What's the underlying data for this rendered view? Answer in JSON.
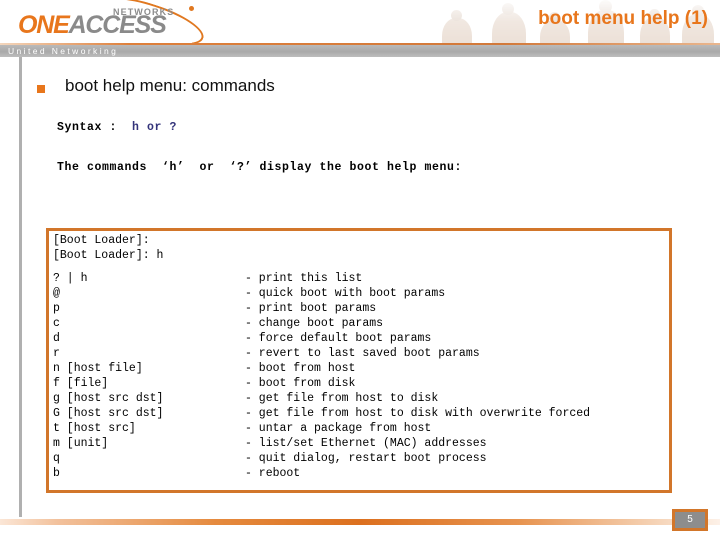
{
  "header": {
    "logo": {
      "networks_word": "NETWORKS",
      "brand_one": "ONE",
      "brand_access": "ACCESS"
    },
    "tagline": "United Networking",
    "slide_title": "boot menu help (1)",
    "accent_color": "#e8761c",
    "gray_bar_color": "#aeaeae"
  },
  "body": {
    "bullet_heading": "boot help menu: commands",
    "syntax": {
      "label": "Syntax :  ",
      "value": "h or ?",
      "value_color": "#33337a"
    },
    "description": "The commands  ‘h’  or  ‘?’ display the boot help menu:"
  },
  "code_box": {
    "border_color": "#d2762a",
    "prompt_lines": [
      "[Boot Loader]:",
      "[Boot Loader]: h"
    ],
    "commands": [
      {
        "key": "? | h",
        "desc": "- print this list"
      },
      {
        "key": "@",
        "desc": "- quick boot with boot params"
      },
      {
        "key": "p",
        "desc": "- print boot params"
      },
      {
        "key": "c",
        "desc": "- change boot params"
      },
      {
        "key": "d",
        "desc": "- force default boot params"
      },
      {
        "key": "r",
        "desc": "- revert to last saved boot params"
      },
      {
        "key": "n [host file]",
        "desc": "- boot from host"
      },
      {
        "key": "f [file]",
        "desc": "- boot from disk"
      },
      {
        "key": "g [host src dst]",
        "desc": "- get file from host to disk"
      },
      {
        "key": "G [host src dst]",
        "desc": "- get file from host to disk with overwrite forced"
      },
      {
        "key": "t [host src]",
        "desc": "- untar a package from host"
      },
      {
        "key": "m [unit]",
        "desc": "- list/set Ethernet (MAC) addresses"
      },
      {
        "key": "q",
        "desc": "- quit dialog, restart boot process"
      },
      {
        "key": "b",
        "desc": "- reboot"
      }
    ]
  },
  "footer": {
    "page_number": "5"
  }
}
